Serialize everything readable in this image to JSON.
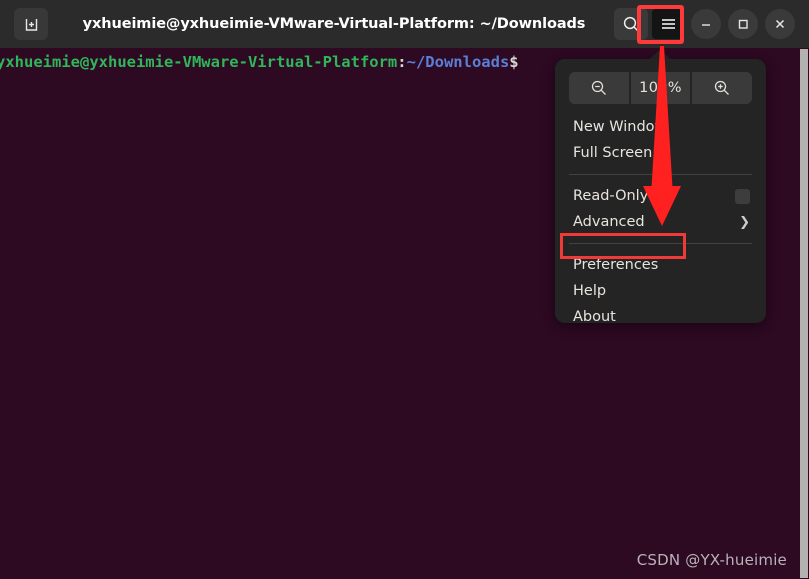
{
  "window": {
    "title": "yxhueimie@yxhueimie-VMware-Virtual-Platform: ~/Downloads",
    "titlebar_bg": "#2b2b2b",
    "new_tab_icon": "new-tab-icon",
    "search_icon": "search-icon",
    "menu_icon": "hamburger-menu-icon",
    "minimize_icon": "minimize-icon",
    "maximize_icon": "maximize-icon",
    "close_icon": "close-icon"
  },
  "terminal": {
    "background": "#2d0922",
    "prompt": {
      "user_host": "yxhueimie@yxhueimie-VMware-Virtual-Platform",
      "colon": ":",
      "path": "~/Downloads",
      "symbol": "$",
      "user_color": "#2fb55a",
      "path_color": "#5c7fd6"
    },
    "cursor": "block-cursor",
    "watermark": "CSDN @YX-hueimie"
  },
  "menu": {
    "zoom": {
      "zoom_out_icon": "zoom-out-icon",
      "level": "100%",
      "zoom_in_icon": "zoom-in-icon"
    },
    "items": [
      {
        "label": "New Window",
        "type": "action"
      },
      {
        "label": "Full Screen",
        "type": "action"
      },
      {
        "label": "Read-Only",
        "type": "checkbox",
        "checked": false
      },
      {
        "label": "Advanced",
        "type": "submenu"
      },
      {
        "label": "Preferences",
        "type": "action",
        "highlighted": true
      },
      {
        "label": "Help",
        "type": "action"
      },
      {
        "label": "About",
        "type": "action"
      }
    ]
  },
  "annotations": {
    "highlight_color": "#ff3a3a",
    "arrow_color": "#ff2020",
    "menu_button_box": "hamburger-menu-highlight",
    "preferences_box": "preferences-highlight",
    "arrow": "red-arrow-pointing-down"
  }
}
